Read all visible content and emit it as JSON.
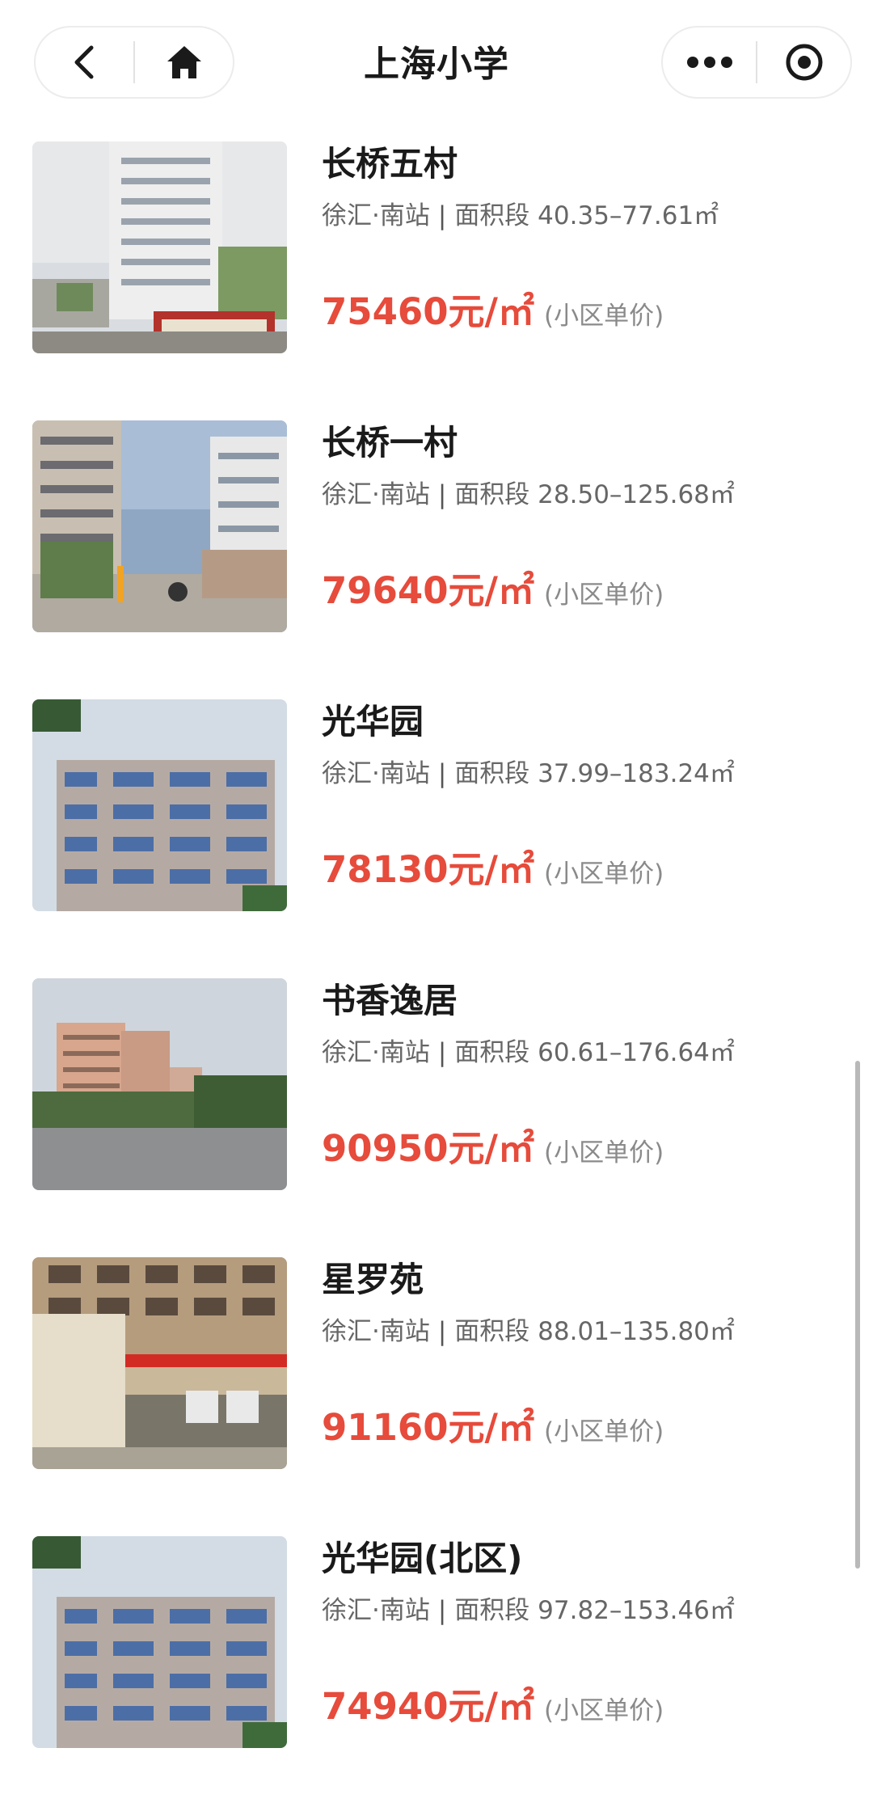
{
  "header": {
    "title": "上海小学",
    "back_icon": "chevron-left-icon",
    "home_icon": "home-icon",
    "more_icon": "more-dots-icon",
    "close_icon": "target-close-icon"
  },
  "colors": {
    "price": "#e64b3b",
    "meta": "#666666",
    "note": "#8a8a8a"
  },
  "listings": [
    {
      "name": "长桥五村",
      "district": "徐汇·南站",
      "separator": "|",
      "area_label": "面积段",
      "area_range": "40.35–77.61㎡",
      "price": "75460元/㎡",
      "price_note": "(小区单价)"
    },
    {
      "name": "长桥一村",
      "district": "徐汇·南站",
      "separator": "|",
      "area_label": "面积段",
      "area_range": "28.50–125.68㎡",
      "price": "79640元/㎡",
      "price_note": "(小区单价)"
    },
    {
      "name": "光华园",
      "district": "徐汇·南站",
      "separator": "|",
      "area_label": "面积段",
      "area_range": "37.99–183.24㎡",
      "price": "78130元/㎡",
      "price_note": "(小区单价)"
    },
    {
      "name": "书香逸居",
      "district": "徐汇·南站",
      "separator": "|",
      "area_label": "面积段",
      "area_range": "60.61–176.64㎡",
      "price": "90950元/㎡",
      "price_note": "(小区单价)"
    },
    {
      "name": "星罗苑",
      "district": "徐汇·南站",
      "separator": "|",
      "area_label": "面积段",
      "area_range": "88.01–135.80㎡",
      "price": "91160元/㎡",
      "price_note": "(小区单价)"
    },
    {
      "name": "光华园(北区)",
      "district": "徐汇·南站",
      "separator": "|",
      "area_label": "面积段",
      "area_range": "97.82–153.46㎡",
      "price": "74940元/㎡",
      "price_note": "(小区单价)"
    }
  ]
}
